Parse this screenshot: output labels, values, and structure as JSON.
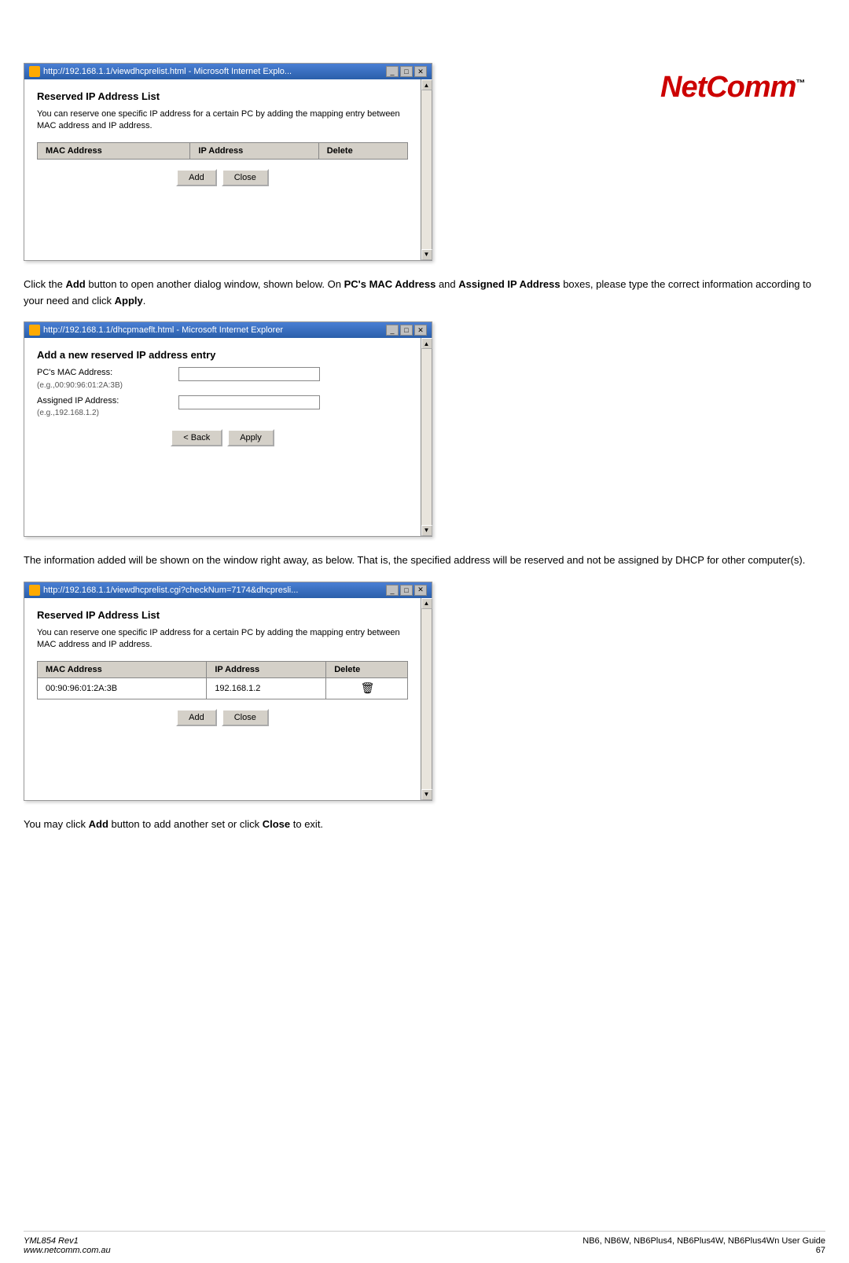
{
  "logo": {
    "text": "NetComm",
    "tm": "™"
  },
  "window1": {
    "title": "http://192.168.1.1/viewdhcprelist.html - Microsoft Internet Explo...",
    "controls": [
      "_",
      "□",
      "✕"
    ],
    "section_title": "Reserved IP Address List",
    "description": "You can reserve one specific IP address for a certain PC by adding the mapping entry between MAC address and IP address.",
    "table": {
      "headers": [
        "MAC Address",
        "IP Address",
        "Delete"
      ],
      "rows": []
    },
    "buttons": {
      "add": "Add",
      "close": "Close"
    }
  },
  "paragraph1": "Click the Add button to open another dialog window, shown below. On PC's MAC Address and Assigned IP Address boxes, please type the correct information according to your need and click Apply.",
  "paragraph1_bold": [
    "Add",
    "PC's MAC Address",
    "Assigned IP Address",
    "Apply"
  ],
  "window2": {
    "title": "http://192.168.1.1/dhcpmaeflt.html - Microsoft Internet Explorer",
    "controls": [
      "_",
      "□",
      "✕"
    ],
    "section_title": "Add a new reserved IP address entry",
    "form": {
      "fields": [
        {
          "label": "PC's MAC Address:",
          "hint": "(e.g.,00:90:96:01:2A:3B)",
          "placeholder": "",
          "value": ""
        },
        {
          "label": "Assigned IP Address:",
          "hint": "(e.g.,192.168.1.2)",
          "placeholder": "",
          "value": ""
        }
      ]
    },
    "buttons": {
      "back": "< Back",
      "apply": "Apply"
    }
  },
  "paragraph2": "The information added will be shown on the window right away, as below. That is, the specified address will be reserved and not be assigned by DHCP for other computer(s).",
  "window3": {
    "title": "http://192.168.1.1/viewdhcprelist.cgi?checkNum=7174&dhcpresli...",
    "controls": [
      "_",
      "□",
      "✕"
    ],
    "section_title": "Reserved IP Address List",
    "description": "You can reserve one specific IP address for a certain PC by adding the mapping entry between MAC address and IP address.",
    "table": {
      "headers": [
        "MAC Address",
        "IP Address",
        "Delete"
      ],
      "rows": [
        {
          "mac": "00:90:96:01:2A:3B",
          "ip": "192.168.1.2",
          "delete": "🗑"
        }
      ]
    },
    "buttons": {
      "add": "Add",
      "close": "Close"
    }
  },
  "paragraph3": "You may click Add button to add another set or click Close to exit.",
  "paragraph3_bold": [
    "Add",
    "Close"
  ],
  "footer": {
    "left_line1": "YML854 Rev1",
    "left_line2": "www.netcomm.com.au",
    "right_line1": "NB6, NB6W, NB6Plus4, NB6Plus4W, NB6Plus4Wn User Guide",
    "right_line2": "67"
  }
}
